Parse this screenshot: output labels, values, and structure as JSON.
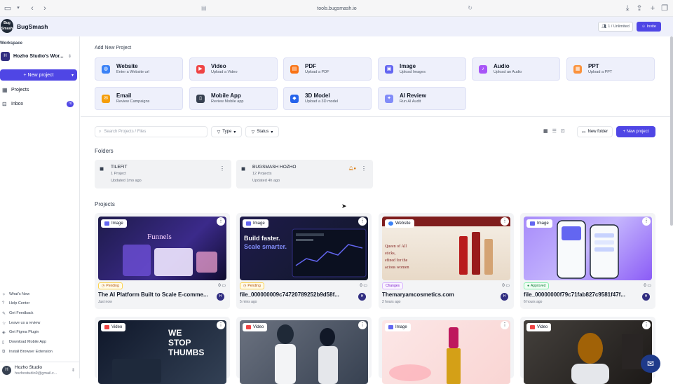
{
  "browser": {
    "url": "tools.bugsmash.io"
  },
  "header": {
    "logo_text": "Bug Smash",
    "brand": "BugSmash",
    "plan": "1 / Unlimited",
    "invite": "Invite"
  },
  "sidebar": {
    "workspace_label": "Workspace",
    "workspace_initial": "H",
    "workspace_name": "Hozho Studio's Wor...",
    "new_project": "+ New project",
    "nav": [
      {
        "label": "Projects"
      },
      {
        "label": "Inbox",
        "badge": "70"
      }
    ],
    "footer_links": [
      "What's New",
      "Help Center",
      "Get Feedback",
      "Leave us a review",
      "Get Figma Plugin",
      "Download Mobile App",
      "Install Browser Extension"
    ],
    "user": {
      "initial": "H",
      "name": "Hozho Studio",
      "email": "hozhostudio9@gmail.c..."
    }
  },
  "add_section": {
    "title": "Add New Project",
    "cards": [
      {
        "title": "Website",
        "sub": "Enter a Website url",
        "color": "#3b82f6",
        "glyph": "◍"
      },
      {
        "title": "Video",
        "sub": "Upload a Video",
        "color": "#ef4444",
        "glyph": "▶"
      },
      {
        "title": "PDF",
        "sub": "Upload a PDF",
        "color": "#f97316",
        "glyph": "▤"
      },
      {
        "title": "Image",
        "sub": "Upload Images",
        "color": "#6366f1",
        "glyph": "▣"
      },
      {
        "title": "Audio",
        "sub": "Upload an Audio",
        "color": "#a855f7",
        "glyph": "♪"
      },
      {
        "title": "PPT",
        "sub": "Upload a PPT",
        "color": "#fb923c",
        "glyph": "▦"
      },
      {
        "title": "Email",
        "sub": "Review Campaigns",
        "color": "#f59e0b",
        "glyph": "✉"
      },
      {
        "title": "Mobile App",
        "sub": "Review Mobile app",
        "color": "#374151",
        "glyph": "▯"
      },
      {
        "title": "3D Model",
        "sub": "Upload a 3D model",
        "color": "#2563eb",
        "glyph": "◆"
      },
      {
        "title": "AI Review",
        "sub": "Run AI Audit",
        "color": "#818cf8",
        "glyph": "✦"
      }
    ]
  },
  "toolbar": {
    "search_placeholder": "Search Projects / Files",
    "type": "Type",
    "status": "Status",
    "new_folder": "New folder",
    "new_project": "+ New project"
  },
  "folders": {
    "title": "Folders",
    "items": [
      {
        "name": "TILEFIT",
        "count": "1 Project",
        "updated": "Updated 1mo ago"
      },
      {
        "name": "BUGSMASH HOZHO",
        "count": "12 Projects",
        "updated": "Updated 4h ago"
      }
    ]
  },
  "projects": {
    "title": "Projects",
    "items": [
      {
        "tag": "Image",
        "status": "Pending",
        "comments": "0",
        "title": "The AI Platform Built to Scale E-comme...",
        "date": "Just now",
        "avatar": "H"
      },
      {
        "tag": "Image",
        "status": "Pending",
        "comments": "0",
        "title": "file_000000009c74720789252b9d58f...",
        "date": "5 mins ago",
        "avatar": "H"
      },
      {
        "tag": "Website",
        "status": "Changes",
        "comments": "0",
        "title": "Themaryamcosmetics.com",
        "date": "2 hours ago",
        "avatar": "H"
      },
      {
        "tag": "Image",
        "status": "Approved",
        "comments": "0",
        "title": "file_00000000f79c71fab827c9581f47f...",
        "date": "6 hours ago",
        "avatar": "H"
      },
      {
        "tag": "Video"
      },
      {
        "tag": "Video"
      },
      {
        "tag": "Image"
      },
      {
        "tag": "Video"
      }
    ]
  },
  "thumb_text": {
    "funnels": "Funnels",
    "build1": "Build faster.",
    "build2": "Scale smarter.",
    "cosmetics": "Queen of All\nsticks,\nefined for the\nacious women",
    "stop": "WE\nSTOP\nTHUMBS"
  }
}
